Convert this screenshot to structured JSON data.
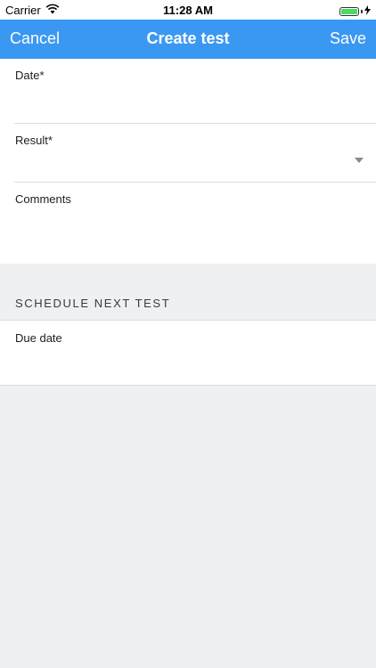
{
  "status_bar": {
    "carrier": "Carrier",
    "time": "11:28 AM"
  },
  "nav": {
    "cancel_label": "Cancel",
    "title": "Create test",
    "save_label": "Save"
  },
  "form": {
    "date_label": "Date*",
    "result_label": "Result*",
    "comments_label": "Comments"
  },
  "schedule": {
    "section_title": "SCHEDULE NEXT TEST",
    "due_date_label": "Due date"
  },
  "colors": {
    "accent": "#3a98f2",
    "background": "#eff0f2",
    "battery": "#4cd964"
  }
}
